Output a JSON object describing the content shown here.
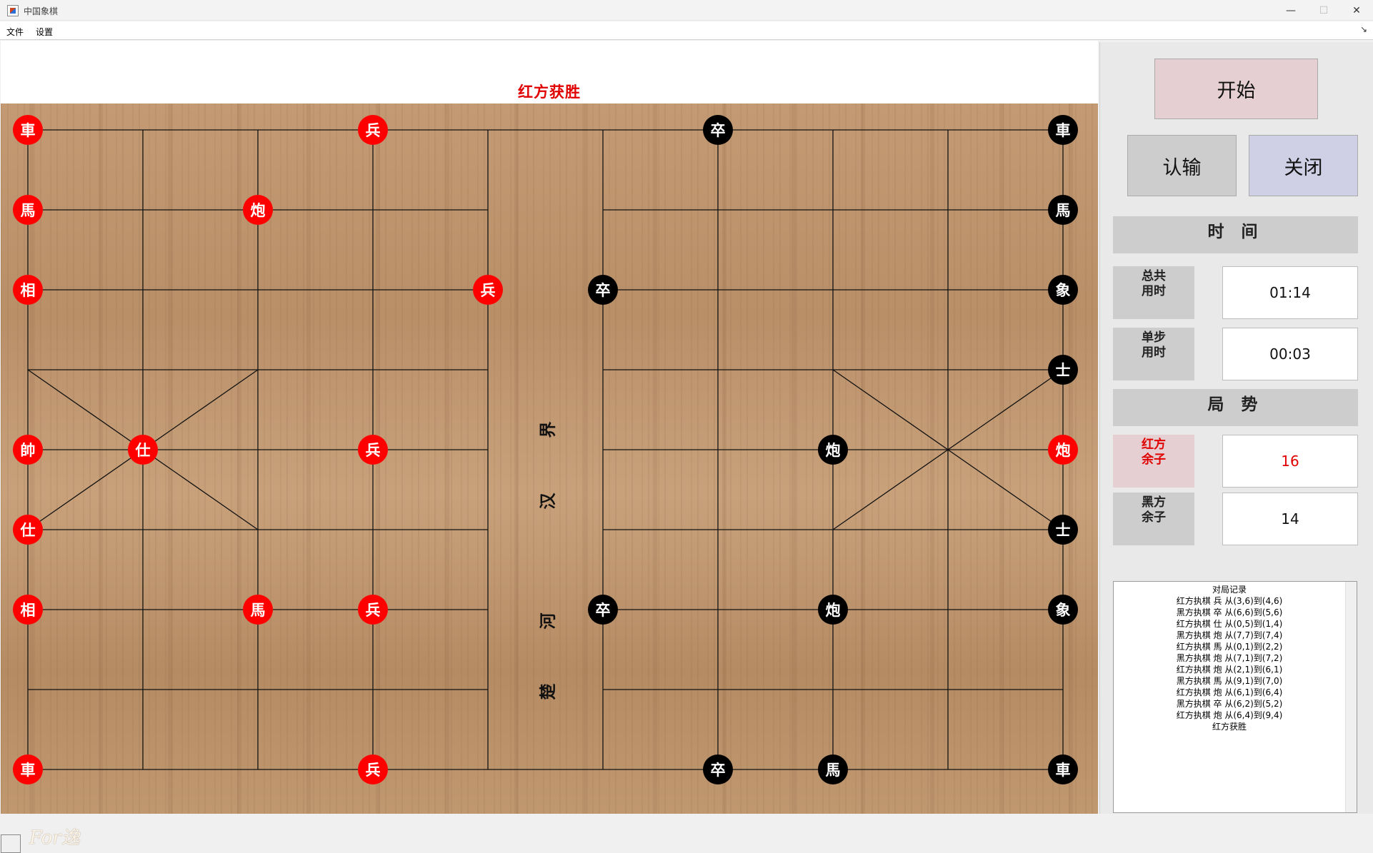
{
  "window": {
    "title": "中国象棋",
    "minimize_icon": "minimize-icon",
    "maximize_icon": "maximize-icon",
    "close_icon": "close-icon"
  },
  "menu": {
    "items": [
      "文件",
      "设置"
    ]
  },
  "status_title": "红方获胜",
  "river_text": [
    "界",
    "汉",
    "河",
    "楚"
  ],
  "signature": "For逸",
  "pieces": [
    {
      "ch": "車",
      "side": "red",
      "col": 0,
      "row": 0
    },
    {
      "ch": "兵",
      "side": "red",
      "col": 3,
      "row": 0
    },
    {
      "ch": "卒",
      "side": "black",
      "col": 6,
      "row": 0
    },
    {
      "ch": "車",
      "side": "black",
      "col": 9,
      "row": 0
    },
    {
      "ch": "馬",
      "side": "red",
      "col": 0,
      "row": 1
    },
    {
      "ch": "炮",
      "side": "red",
      "col": 2,
      "row": 1
    },
    {
      "ch": "馬",
      "side": "black",
      "col": 9,
      "row": 1
    },
    {
      "ch": "相",
      "side": "red",
      "col": 0,
      "row": 2
    },
    {
      "ch": "兵",
      "side": "red",
      "col": 4,
      "row": 2
    },
    {
      "ch": "卒",
      "side": "black",
      "col": 5,
      "row": 2
    },
    {
      "ch": "象",
      "side": "black",
      "col": 9,
      "row": 2
    },
    {
      "ch": "士",
      "side": "black",
      "col": 9,
      "row": 3
    },
    {
      "ch": "帥",
      "side": "red",
      "col": 0,
      "row": 4
    },
    {
      "ch": "仕",
      "side": "red",
      "col": 1,
      "row": 4
    },
    {
      "ch": "兵",
      "side": "red",
      "col": 3,
      "row": 4
    },
    {
      "ch": "炮",
      "side": "black",
      "col": 7,
      "row": 4
    },
    {
      "ch": "炮",
      "side": "red",
      "col": 9,
      "row": 4
    },
    {
      "ch": "仕",
      "side": "red",
      "col": 0,
      "row": 5
    },
    {
      "ch": "士",
      "side": "black",
      "col": 9,
      "row": 5
    },
    {
      "ch": "相",
      "side": "red",
      "col": 0,
      "row": 6
    },
    {
      "ch": "馬",
      "side": "red",
      "col": 2,
      "row": 6
    },
    {
      "ch": "兵",
      "side": "red",
      "col": 3,
      "row": 6
    },
    {
      "ch": "卒",
      "side": "black",
      "col": 5,
      "row": 6
    },
    {
      "ch": "炮",
      "side": "black",
      "col": 7,
      "row": 6
    },
    {
      "ch": "象",
      "side": "black",
      "col": 9,
      "row": 6
    },
    {
      "ch": "車",
      "side": "red",
      "col": 0,
      "row": 8
    },
    {
      "ch": "兵",
      "side": "red",
      "col": 3,
      "row": 8
    },
    {
      "ch": "卒",
      "side": "black",
      "col": 6,
      "row": 8
    },
    {
      "ch": "馬",
      "side": "black",
      "col": 7,
      "row": 8
    },
    {
      "ch": "車",
      "side": "black",
      "col": 9,
      "row": 8
    }
  ],
  "controls": {
    "start_label": "开始",
    "resign_label": "认输",
    "close_label": "关闭",
    "time_header": "时 间",
    "total_time_label": [
      "总共",
      "用时"
    ],
    "total_time_value": "01:14",
    "step_time_label": [
      "单步",
      "用时"
    ],
    "step_time_value": "00:03",
    "situation_header": "局 势",
    "red_left_label": [
      "红方",
      "余子"
    ],
    "red_left_value": "16",
    "black_left_label": [
      "黑方",
      "余子"
    ],
    "black_left_value": "14"
  },
  "colors": {
    "red": "#ff0000",
    "black": "#000000",
    "start_bg": "#e6cfd2",
    "close_bg": "#cfcfe6",
    "resign_bg": "#cdcdcd"
  },
  "log": {
    "title": "对局记录",
    "entries": [
      "红方执棋 兵 从(3,6)到(4,6)",
      "黑方执棋 卒 从(6,6)到(5,6)",
      "红方执棋 仕 从(0,5)到(1,4)",
      "黑方执棋 炮 从(7,7)到(7,4)",
      "红方执棋 馬 从(0,1)到(2,2)",
      "黑方执棋 炮 从(7,1)到(7,2)",
      "红方执棋 炮 从(2,1)到(6,1)",
      "黑方执棋 馬 从(9,1)到(7,0)",
      "红方执棋 炮 从(6,1)到(6,4)",
      "黑方执棋 卒 从(6,2)到(5,2)",
      "红方执棋 炮 从(6,4)到(9,4)",
      "红方获胜"
    ]
  }
}
